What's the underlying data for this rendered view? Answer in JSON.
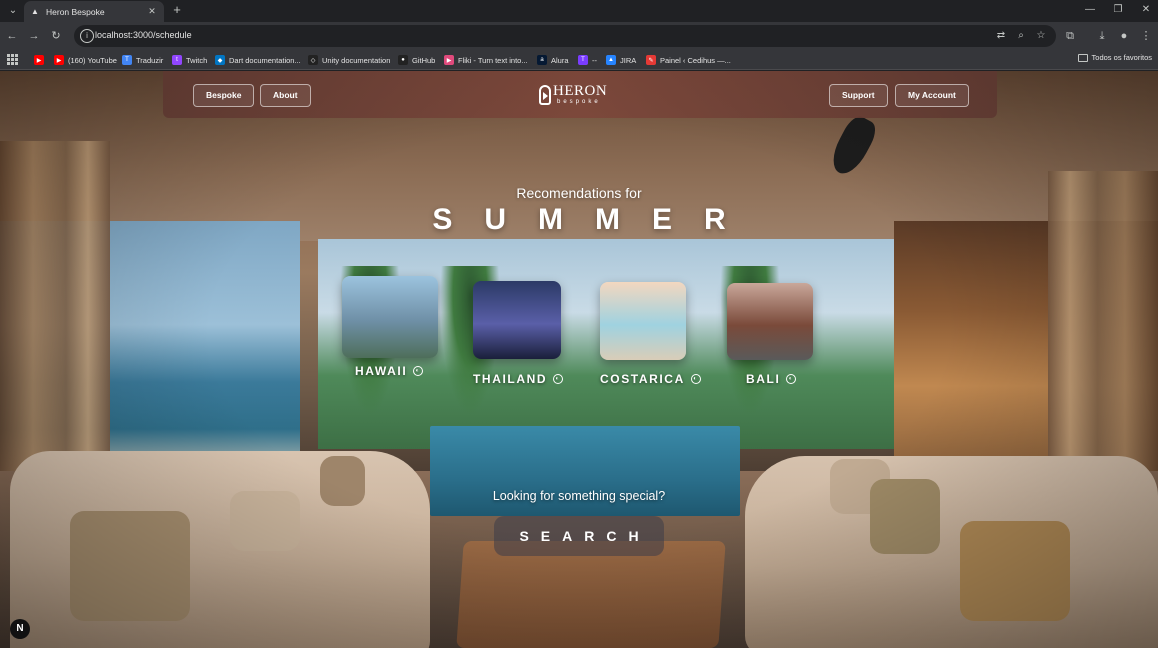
{
  "browser": {
    "tab_title": "Heron Bespoke",
    "url": "localhost:3000/schedule",
    "bookmarks": [
      {
        "label": "(160) YouTube",
        "icon": "youtube-icon",
        "color": "#ff0000"
      },
      {
        "label": "Traduzir",
        "icon": "translate-icon",
        "color": "#4285f4"
      },
      {
        "label": "Twitch",
        "icon": "twitch-icon",
        "color": "#9146ff"
      },
      {
        "label": "Dart documentation...",
        "icon": "dart-icon",
        "color": "#0175c2"
      },
      {
        "label": "Unity documentation",
        "icon": "unity-icon",
        "color": "#222222"
      },
      {
        "label": "GitHub",
        "icon": "github-icon",
        "color": "#222222"
      },
      {
        "label": "Fliki - Turn text into...",
        "icon": "fliki-icon",
        "color": "#e04a7c"
      },
      {
        "label": "Alura",
        "icon": "alura-icon",
        "color": "#051933"
      },
      {
        "label": "--",
        "icon": "t-icon",
        "color": "#7a3cff"
      },
      {
        "label": "JIRA",
        "icon": "jira-icon",
        "color": "#2684ff"
      },
      {
        "label": "Painel ‹ Cedihus —...",
        "icon": "pin-icon",
        "color": "#e53935"
      }
    ],
    "bookmarks_folder": "Todos os favoritos"
  },
  "nav": {
    "bespoke": "Bespoke",
    "about": "About",
    "support": "Support",
    "account": "My Account",
    "logo_name": "HERON",
    "logo_sub": "bespoke"
  },
  "hero": {
    "subtitle": "Recomendations for",
    "season": "SUMMER"
  },
  "destinations": [
    {
      "name": "HAWAII",
      "palette": [
        "#9cc3de",
        "#6e8fa6",
        "#4e6e5a"
      ]
    },
    {
      "name": "THAILAND",
      "palette": [
        "#2b3a66",
        "#5a5fa8",
        "#1a1f3a"
      ]
    },
    {
      "name": "COSTARICA",
      "palette": [
        "#f3d7bf",
        "#9fd2e0",
        "#d9cdb8"
      ]
    },
    {
      "name": "BALI",
      "palette": [
        "#c9a79a",
        "#7a4a3a",
        "#5a5a5a"
      ]
    }
  ],
  "special": {
    "prompt": "Looking for something special?",
    "button": "SEARCH"
  },
  "dev_badge": "N"
}
